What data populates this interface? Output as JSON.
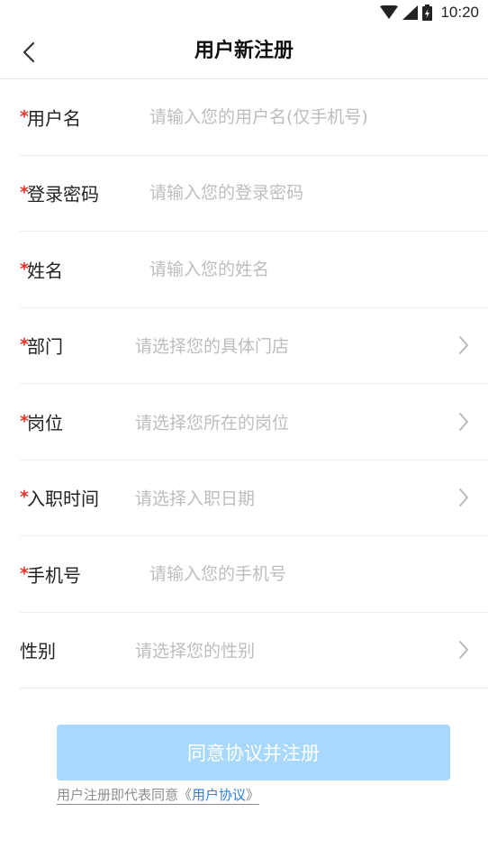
{
  "status_bar": {
    "time": "10:20",
    "icons": [
      "wifi-icon",
      "signal-icon",
      "battery-icon"
    ]
  },
  "nav": {
    "title": "用户新注册",
    "back_icon": "chevron-left-icon"
  },
  "form": {
    "rows": [
      {
        "name": "username",
        "required": true,
        "required_mark": "*",
        "label": "用户名",
        "type": "input",
        "value": "",
        "placeholder": "请输入您的用户名(仅手机号)"
      },
      {
        "name": "password",
        "required": true,
        "required_mark": "*",
        "label": "登录密码",
        "type": "input",
        "value": "",
        "placeholder": "请输入您的登录密码"
      },
      {
        "name": "fullname",
        "required": true,
        "required_mark": "*",
        "label": "姓名",
        "type": "input",
        "value": "",
        "placeholder": "请输入您的姓名"
      },
      {
        "name": "department",
        "required": true,
        "required_mark": "*",
        "label": "部门",
        "type": "select",
        "placeholder": "请选择您的具体门店"
      },
      {
        "name": "position",
        "required": true,
        "required_mark": "*",
        "label": "岗位",
        "type": "select",
        "placeholder": "请选择您所在的岗位"
      },
      {
        "name": "hire-date",
        "required": true,
        "required_mark": "*",
        "label": "入职时间",
        "type": "select",
        "placeholder": "请选择入职日期"
      },
      {
        "name": "phone",
        "required": true,
        "required_mark": "*",
        "label": "手机号",
        "type": "input",
        "value": "",
        "placeholder": "请输入您的手机号"
      },
      {
        "name": "gender",
        "required": false,
        "required_mark": "",
        "label": "性别",
        "type": "select",
        "placeholder": "请选择您的性别"
      }
    ]
  },
  "submit": {
    "label": "同意协议并注册"
  },
  "agreement": {
    "prefix": "用户注册即代表同意《",
    "link": "用户协议",
    "suffix": "》"
  },
  "colors": {
    "required": "#e0342b",
    "button_bg": "#a8d8fb",
    "link": "#2d7fe0",
    "placeholder": "#bdbdbd"
  }
}
